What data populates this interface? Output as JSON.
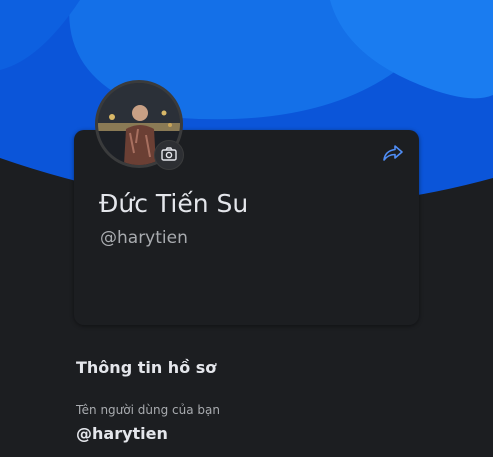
{
  "profile": {
    "name": "Đức Tiến Su",
    "handle": "@harytien"
  },
  "icons": {
    "camera": "camera-icon",
    "share": "share-icon"
  },
  "section": {
    "title": "Thông tin hồ sơ",
    "username_label": "Tên người dùng của bạn",
    "username_value": "@harytien"
  },
  "colors": {
    "accent": "#4f8df5",
    "hero_blue": "#0a5ce8",
    "background": "#1c1e21"
  }
}
